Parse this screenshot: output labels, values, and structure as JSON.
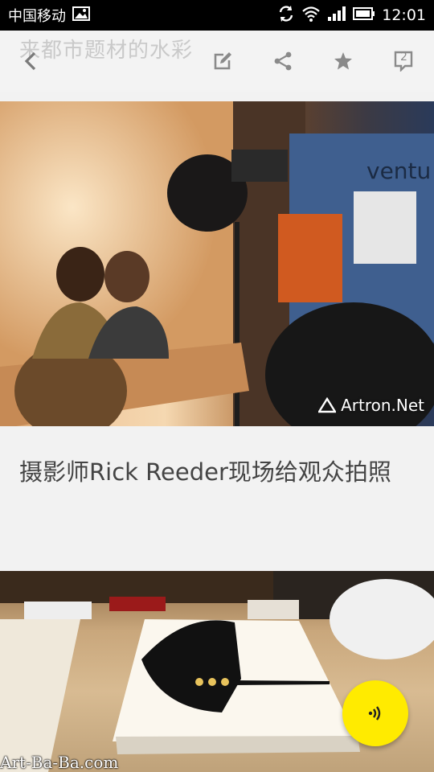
{
  "status_bar": {
    "carrier": "中国移动",
    "time": "12:01"
  },
  "toolbar": {
    "ghost_title": "来都市题材的水彩",
    "icons": [
      "back-icon",
      "edit-icon",
      "share-icon",
      "star-icon",
      "comment-icon"
    ],
    "comment_count": "2"
  },
  "article": {
    "photo1_watermark": "Artron.Net",
    "photo1_sign_text": "ventu",
    "caption": "摄影师Rick Reeder现场给观众拍照"
  },
  "footer": {
    "corner_watermark": "Art-Ba-Ba.com"
  },
  "colors": {
    "fab": "#ffeb00",
    "icon_gray": "#8a8a8a"
  }
}
